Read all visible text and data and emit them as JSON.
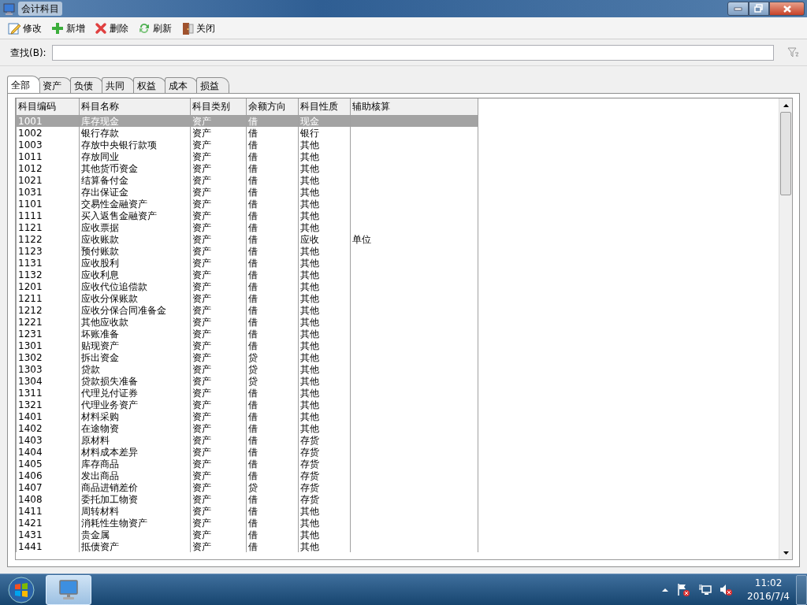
{
  "window": {
    "title": "会计科目"
  },
  "toolbar": [
    {
      "label": "修改",
      "kind": "edit"
    },
    {
      "label": "新增",
      "kind": "add"
    },
    {
      "label": "删除",
      "kind": "delete"
    },
    {
      "label": "刷新",
      "kind": "refresh"
    },
    {
      "label": "关闭",
      "kind": "close"
    }
  ],
  "search": {
    "label": "查找(B):"
  },
  "tabs": [
    {
      "label": "全部",
      "selected": true
    },
    {
      "label": "资产",
      "selected": false
    },
    {
      "label": "负债",
      "selected": false
    },
    {
      "label": "共同",
      "selected": false
    },
    {
      "label": "权益",
      "selected": false
    },
    {
      "label": "成本",
      "selected": false
    },
    {
      "label": "损益",
      "selected": false
    }
  ],
  "table": {
    "columns": [
      "科目编码",
      "科目名称",
      "科目类别",
      "余额方向",
      "科目性质",
      "辅助核算"
    ],
    "rows": [
      {
        "cells": [
          "1001",
          "库存现金",
          "资产",
          "借",
          "现金",
          ""
        ],
        "selected": true
      },
      {
        "cells": [
          "1002",
          "银行存款",
          "资产",
          "借",
          "银行",
          ""
        ],
        "selected": false
      },
      {
        "cells": [
          "1003",
          "存放中央银行款项",
          "资产",
          "借",
          "其他",
          ""
        ],
        "selected": false
      },
      {
        "cells": [
          "1011",
          "存放同业",
          "资产",
          "借",
          "其他",
          ""
        ],
        "selected": false
      },
      {
        "cells": [
          "1012",
          "其他货币资金",
          "资产",
          "借",
          "其他",
          ""
        ],
        "selected": false
      },
      {
        "cells": [
          "1021",
          "结算备付金",
          "资产",
          "借",
          "其他",
          ""
        ],
        "selected": false
      },
      {
        "cells": [
          "1031",
          "存出保证金",
          "资产",
          "借",
          "其他",
          ""
        ],
        "selected": false
      },
      {
        "cells": [
          "1101",
          "交易性金融资产",
          "资产",
          "借",
          "其他",
          ""
        ],
        "selected": false
      },
      {
        "cells": [
          "1111",
          "买入返售金融资产",
          "资产",
          "借",
          "其他",
          ""
        ],
        "selected": false
      },
      {
        "cells": [
          "1121",
          "应收票据",
          "资产",
          "借",
          "其他",
          ""
        ],
        "selected": false
      },
      {
        "cells": [
          "1122",
          "应收账款",
          "资产",
          "借",
          "应收",
          "单位"
        ],
        "selected": false
      },
      {
        "cells": [
          "1123",
          "预付账款",
          "资产",
          "借",
          "其他",
          ""
        ],
        "selected": false
      },
      {
        "cells": [
          "1131",
          "应收股利",
          "资产",
          "借",
          "其他",
          ""
        ],
        "selected": false
      },
      {
        "cells": [
          "1132",
          "应收利息",
          "资产",
          "借",
          "其他",
          ""
        ],
        "selected": false
      },
      {
        "cells": [
          "1201",
          "应收代位追偿款",
          "资产",
          "借",
          "其他",
          ""
        ],
        "selected": false
      },
      {
        "cells": [
          "1211",
          "应收分保账款",
          "资产",
          "借",
          "其他",
          ""
        ],
        "selected": false
      },
      {
        "cells": [
          "1212",
          "应收分保合同准备金",
          "资产",
          "借",
          "其他",
          ""
        ],
        "selected": false
      },
      {
        "cells": [
          "1221",
          "其他应收款",
          "资产",
          "借",
          "其他",
          ""
        ],
        "selected": false
      },
      {
        "cells": [
          "1231",
          "坏账准备",
          "资产",
          "借",
          "其他",
          ""
        ],
        "selected": false
      },
      {
        "cells": [
          "1301",
          "贴现资产",
          "资产",
          "借",
          "其他",
          ""
        ],
        "selected": false
      },
      {
        "cells": [
          "1302",
          "拆出资金",
          "资产",
          "贷",
          "其他",
          ""
        ],
        "selected": false
      },
      {
        "cells": [
          "1303",
          "贷款",
          "资产",
          "贷",
          "其他",
          ""
        ],
        "selected": false
      },
      {
        "cells": [
          "1304",
          "贷款损失准备",
          "资产",
          "贷",
          "其他",
          ""
        ],
        "selected": false
      },
      {
        "cells": [
          "1311",
          "代理兑付证券",
          "资产",
          "借",
          "其他",
          ""
        ],
        "selected": false
      },
      {
        "cells": [
          "1321",
          "代理业务资产",
          "资产",
          "借",
          "其他",
          ""
        ],
        "selected": false
      },
      {
        "cells": [
          "1401",
          "材料采购",
          "资产",
          "借",
          "其他",
          ""
        ],
        "selected": false
      },
      {
        "cells": [
          "1402",
          "在途物资",
          "资产",
          "借",
          "其他",
          ""
        ],
        "selected": false
      },
      {
        "cells": [
          "1403",
          "原材料",
          "资产",
          "借",
          "存货",
          ""
        ],
        "selected": false
      },
      {
        "cells": [
          "1404",
          "材料成本差异",
          "资产",
          "借",
          "存货",
          ""
        ],
        "selected": false
      },
      {
        "cells": [
          "1405",
          "库存商品",
          "资产",
          "借",
          "存货",
          ""
        ],
        "selected": false
      },
      {
        "cells": [
          "1406",
          "发出商品",
          "资产",
          "借",
          "存货",
          ""
        ],
        "selected": false
      },
      {
        "cells": [
          "1407",
          "商品进销差价",
          "资产",
          "贷",
          "存货",
          ""
        ],
        "selected": false
      },
      {
        "cells": [
          "1408",
          "委托加工物资",
          "资产",
          "借",
          "存货",
          ""
        ],
        "selected": false
      },
      {
        "cells": [
          "1411",
          "周转材料",
          "资产",
          "借",
          "其他",
          ""
        ],
        "selected": false
      },
      {
        "cells": [
          "1421",
          "消耗性生物资产",
          "资产",
          "借",
          "其他",
          ""
        ],
        "selected": false
      },
      {
        "cells": [
          "1431",
          "贵金属",
          "资产",
          "借",
          "其他",
          ""
        ],
        "selected": false
      },
      {
        "cells": [
          "1441",
          "抵债资产",
          "资产",
          "借",
          "其他",
          ""
        ],
        "selected": false
      }
    ]
  },
  "taskbar": {
    "time": "11:02",
    "date": "2016/7/4"
  }
}
